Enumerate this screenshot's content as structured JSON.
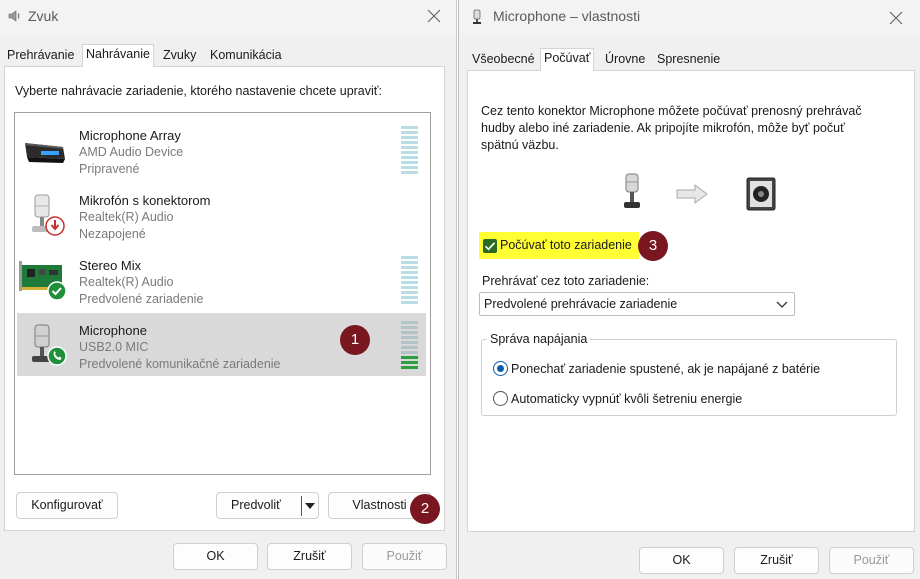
{
  "sound": {
    "title": "Zvuk",
    "tabs": [
      "Prehrávanie",
      "Nahrávanie",
      "Zvuky",
      "Komunikácia"
    ],
    "instruction": "Vyberte nahrávacie zariadenie, ktorého nastavenie chcete upraviť:",
    "devices": [
      {
        "name": "Microphone Array",
        "driver": "AMD Audio Device",
        "status": "Pripravené"
      },
      {
        "name": "Mikrofón s konektorom",
        "driver": "Realtek(R) Audio",
        "status": "Nezapojené"
      },
      {
        "name": "Stereo Mix",
        "driver": "Realtek(R) Audio",
        "status": "Predvolené zariadenie"
      },
      {
        "name": "Microphone",
        "driver": "USB2.0 MIC",
        "status": "Predvolené komunikačné zariadenie"
      }
    ],
    "buttons": {
      "configure": "Konfigurovať",
      "set_default": "Predvoliť",
      "properties": "Vlastnosti",
      "ok": "OK",
      "cancel": "Zrušiť",
      "apply": "Použiť"
    },
    "badges": [
      "1",
      "2"
    ]
  },
  "props": {
    "title": "Microphone – vlastnosti",
    "tabs": [
      "Všeobecné",
      "Počúvať",
      "Úrovne",
      "Spresnenie"
    ],
    "description": "Cez tento konektor Microphone môžete počúvať prenosný prehrávač hudby alebo iné zariadenie. Ak pripojíte mikrofón, môže byť počuť spätnú väzbu.",
    "listen_label": "Počúvať toto zariadenie",
    "listen_checked": true,
    "playback_label": "Prehrávať cez toto zariadenie:",
    "playback_value": "Predvolené prehrávacie zariadenie",
    "power_group": "Správa napájania",
    "power_options": [
      "Ponechať zariadenie spustené, ak je napájané z batérie",
      "Automaticky vypnúť kvôli šetreniu energie"
    ],
    "power_selected": 0,
    "buttons": {
      "ok": "OK",
      "cancel": "Zrušiť",
      "apply": "Použiť"
    },
    "badge": "3",
    "highlight_color": "#ffff33"
  },
  "colors": {
    "accent": "#0b5cad",
    "badge": "#7a1620",
    "meter_active": "#2e9f3e",
    "selected_row": "#d9d9d9"
  },
  "icons": [
    "speaker-icon",
    "microphone-icon",
    "close-icon",
    "arrow-right-icon",
    "chevron-down-icon",
    "check-status-icon",
    "phone-status-icon",
    "unplugged-status-icon"
  ]
}
